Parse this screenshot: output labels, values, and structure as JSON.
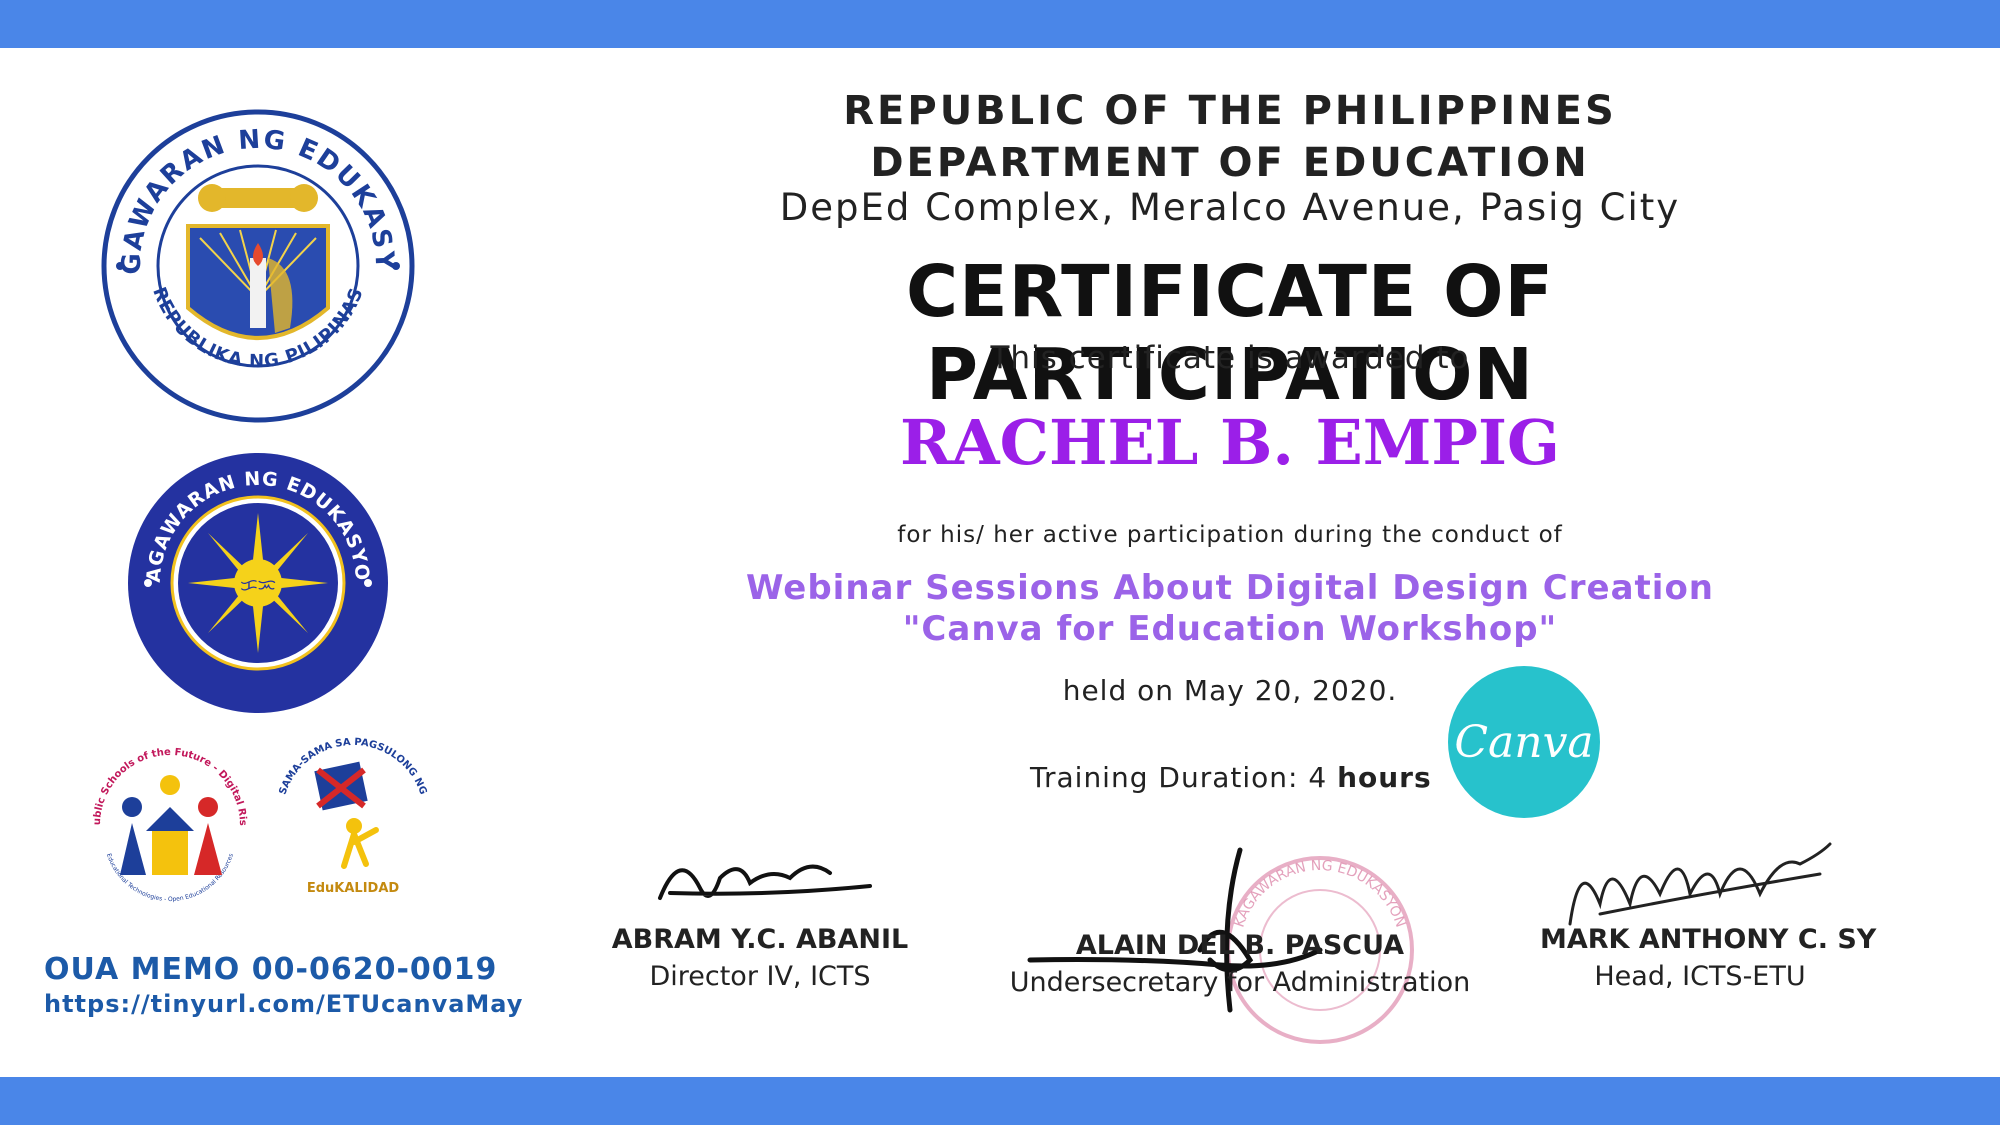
{
  "header": {
    "line1": "REPUBLIC OF THE PHILIPPINES",
    "line2": "DEPARTMENT OF EDUCATION",
    "address": "DepEd Complex, Meralco Avenue, Pasig City"
  },
  "certificate": {
    "title": "CERTIFICATE OF PARTICIPATION",
    "awarded_to": "This certificate is awarded to",
    "recipient": "RACHEL B. EMPIG",
    "for_line": "for his/ her active participation during the conduct of",
    "event_line1": "Webinar Sessions About Digital Design Creation",
    "event_line2": "\"Canva for Education Workshop\"",
    "held_on": "held on May 20, 2020.",
    "duration_label": "Training Duration: 4",
    "duration_unit": "hours"
  },
  "logos": {
    "deped_seal_top": "KAGAWARAN NG EDUKASYON",
    "deped_seal_bottom": "REPUBLIKA NG PILIPINAS",
    "sun_seal_text": "KAGAWARAN NG EDUKASYON",
    "psf_text": "Public Schools of the Future - Digital Rise",
    "psf_bottom": "Educational Technologies - Open Educational Resources",
    "edukalidad_text": "SAMA-SAMA SA PAGSULONG NG",
    "edukalidad_bottom": "EduKALIDAD",
    "canva_wordmark": "Canva",
    "stamp_text": "KAGAWARAN NG EDUKASYON"
  },
  "signatories": [
    {
      "name": "ABRAM Y.C. ABANIL",
      "title": "Director IV, ICTS"
    },
    {
      "name": "ALAIN DEL B. PASCUA",
      "title": "Undersecretary for Administration"
    },
    {
      "name": "MARK ANTHONY C. SY",
      "title": "Head, ICTS-ETU"
    }
  ],
  "footer": {
    "memo": "OUA MEMO 00-0620-0019",
    "url": "https://tinyurl.com/ETUcanvaMay"
  },
  "colors": {
    "band": "#4a86e8",
    "recipient": "#9b1fe8",
    "event": "#9b63e8",
    "memo": "#1c5aa8",
    "canva": "#27c2cc"
  }
}
